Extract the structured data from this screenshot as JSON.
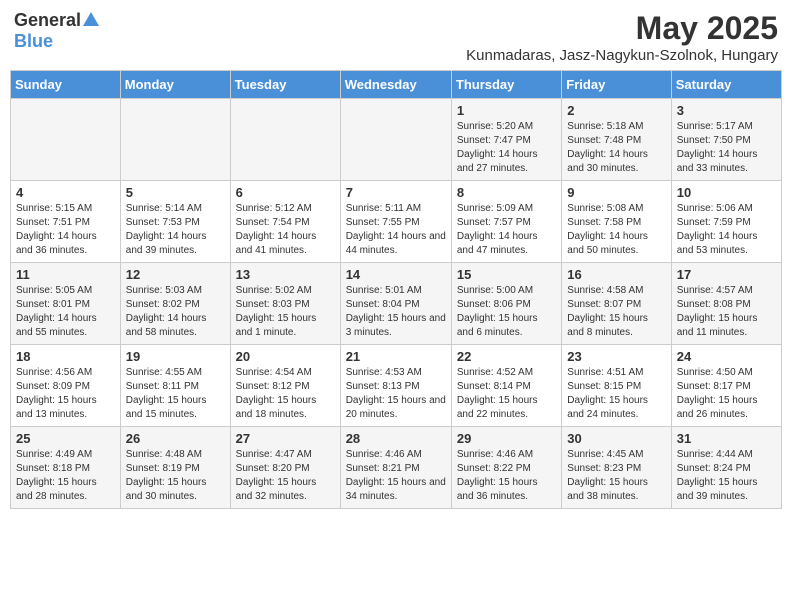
{
  "logo": {
    "general": "General",
    "blue": "Blue"
  },
  "title": "May 2025",
  "location": "Kunmadaras, Jasz-Nagykun-Szolnok, Hungary",
  "weekdays": [
    "Sunday",
    "Monday",
    "Tuesday",
    "Wednesday",
    "Thursday",
    "Friday",
    "Saturday"
  ],
  "weeks": [
    [
      {
        "day": "",
        "info": ""
      },
      {
        "day": "",
        "info": ""
      },
      {
        "day": "",
        "info": ""
      },
      {
        "day": "",
        "info": ""
      },
      {
        "day": "1",
        "info": "Sunrise: 5:20 AM\nSunset: 7:47 PM\nDaylight: 14 hours and 27 minutes."
      },
      {
        "day": "2",
        "info": "Sunrise: 5:18 AM\nSunset: 7:48 PM\nDaylight: 14 hours and 30 minutes."
      },
      {
        "day": "3",
        "info": "Sunrise: 5:17 AM\nSunset: 7:50 PM\nDaylight: 14 hours and 33 minutes."
      }
    ],
    [
      {
        "day": "4",
        "info": "Sunrise: 5:15 AM\nSunset: 7:51 PM\nDaylight: 14 hours and 36 minutes."
      },
      {
        "day": "5",
        "info": "Sunrise: 5:14 AM\nSunset: 7:53 PM\nDaylight: 14 hours and 39 minutes."
      },
      {
        "day": "6",
        "info": "Sunrise: 5:12 AM\nSunset: 7:54 PM\nDaylight: 14 hours and 41 minutes."
      },
      {
        "day": "7",
        "info": "Sunrise: 5:11 AM\nSunset: 7:55 PM\nDaylight: 14 hours and 44 minutes."
      },
      {
        "day": "8",
        "info": "Sunrise: 5:09 AM\nSunset: 7:57 PM\nDaylight: 14 hours and 47 minutes."
      },
      {
        "day": "9",
        "info": "Sunrise: 5:08 AM\nSunset: 7:58 PM\nDaylight: 14 hours and 50 minutes."
      },
      {
        "day": "10",
        "info": "Sunrise: 5:06 AM\nSunset: 7:59 PM\nDaylight: 14 hours and 53 minutes."
      }
    ],
    [
      {
        "day": "11",
        "info": "Sunrise: 5:05 AM\nSunset: 8:01 PM\nDaylight: 14 hours and 55 minutes."
      },
      {
        "day": "12",
        "info": "Sunrise: 5:03 AM\nSunset: 8:02 PM\nDaylight: 14 hours and 58 minutes."
      },
      {
        "day": "13",
        "info": "Sunrise: 5:02 AM\nSunset: 8:03 PM\nDaylight: 15 hours and 1 minute."
      },
      {
        "day": "14",
        "info": "Sunrise: 5:01 AM\nSunset: 8:04 PM\nDaylight: 15 hours and 3 minutes."
      },
      {
        "day": "15",
        "info": "Sunrise: 5:00 AM\nSunset: 8:06 PM\nDaylight: 15 hours and 6 minutes."
      },
      {
        "day": "16",
        "info": "Sunrise: 4:58 AM\nSunset: 8:07 PM\nDaylight: 15 hours and 8 minutes."
      },
      {
        "day": "17",
        "info": "Sunrise: 4:57 AM\nSunset: 8:08 PM\nDaylight: 15 hours and 11 minutes."
      }
    ],
    [
      {
        "day": "18",
        "info": "Sunrise: 4:56 AM\nSunset: 8:09 PM\nDaylight: 15 hours and 13 minutes."
      },
      {
        "day": "19",
        "info": "Sunrise: 4:55 AM\nSunset: 8:11 PM\nDaylight: 15 hours and 15 minutes."
      },
      {
        "day": "20",
        "info": "Sunrise: 4:54 AM\nSunset: 8:12 PM\nDaylight: 15 hours and 18 minutes."
      },
      {
        "day": "21",
        "info": "Sunrise: 4:53 AM\nSunset: 8:13 PM\nDaylight: 15 hours and 20 minutes."
      },
      {
        "day": "22",
        "info": "Sunrise: 4:52 AM\nSunset: 8:14 PM\nDaylight: 15 hours and 22 minutes."
      },
      {
        "day": "23",
        "info": "Sunrise: 4:51 AM\nSunset: 8:15 PM\nDaylight: 15 hours and 24 minutes."
      },
      {
        "day": "24",
        "info": "Sunrise: 4:50 AM\nSunset: 8:17 PM\nDaylight: 15 hours and 26 minutes."
      }
    ],
    [
      {
        "day": "25",
        "info": "Sunrise: 4:49 AM\nSunset: 8:18 PM\nDaylight: 15 hours and 28 minutes."
      },
      {
        "day": "26",
        "info": "Sunrise: 4:48 AM\nSunset: 8:19 PM\nDaylight: 15 hours and 30 minutes."
      },
      {
        "day": "27",
        "info": "Sunrise: 4:47 AM\nSunset: 8:20 PM\nDaylight: 15 hours and 32 minutes."
      },
      {
        "day": "28",
        "info": "Sunrise: 4:46 AM\nSunset: 8:21 PM\nDaylight: 15 hours and 34 minutes."
      },
      {
        "day": "29",
        "info": "Sunrise: 4:46 AM\nSunset: 8:22 PM\nDaylight: 15 hours and 36 minutes."
      },
      {
        "day": "30",
        "info": "Sunrise: 4:45 AM\nSunset: 8:23 PM\nDaylight: 15 hours and 38 minutes."
      },
      {
        "day": "31",
        "info": "Sunrise: 4:44 AM\nSunset: 8:24 PM\nDaylight: 15 hours and 39 minutes."
      }
    ]
  ]
}
